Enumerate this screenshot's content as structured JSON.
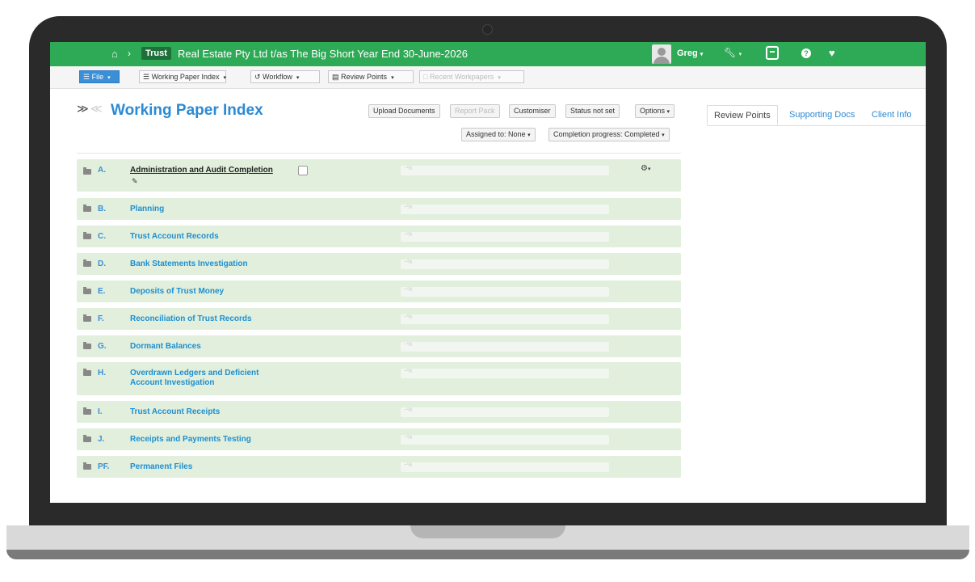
{
  "header": {
    "badge": "Trust",
    "title": "Real Estate Pty Ltd t/as The Big Short  Year End 30-June-2026",
    "user": "Greg",
    "colors": {
      "bar": "#2eaa56",
      "badge": "#1f6f3a"
    }
  },
  "toolbar": {
    "file": "File",
    "working_paper_index": "Working Paper Index",
    "workflow": "Workflow",
    "review_points": "Review Points",
    "recent_workpapers": "Recent Workpapers"
  },
  "main": {
    "title": "Working Paper Index",
    "buttons": {
      "upload": "Upload Documents",
      "report_pack": "Report Pack",
      "customiser": "Customiser",
      "status": "Status not set",
      "options": "Options",
      "assigned": "Assigned to: None",
      "completion": "Completion progress: Completed"
    },
    "rows": [
      {
        "code": "A.",
        "name": "Administration and Audit Completion",
        "bar": "~%"
      },
      {
        "code": "B.",
        "name": "Planning",
        "bar": "~%"
      },
      {
        "code": "C.",
        "name": "Trust Account Records",
        "bar": "~%"
      },
      {
        "code": "D.",
        "name": "Bank Statements Investigation",
        "bar": "~%"
      },
      {
        "code": "E.",
        "name": "Deposits of Trust Money",
        "bar": "~%"
      },
      {
        "code": "F.",
        "name": "Reconciliation of Trust Records",
        "bar": "~%"
      },
      {
        "code": "G.",
        "name": "Dormant Balances",
        "bar": "~%"
      },
      {
        "code": "H.",
        "name": "Overdrawn Ledgers and Deficient Account Investigation",
        "bar": "~%"
      },
      {
        "code": "I.",
        "name": "Trust Account Receipts",
        "bar": "~%"
      },
      {
        "code": "J.",
        "name": "Receipts and Payments Testing",
        "bar": "~%"
      },
      {
        "code": "PF.",
        "name": "Permanent Files",
        "bar": "~%"
      }
    ]
  },
  "tabs": {
    "review_points": "Review Points",
    "supporting_docs": "Supporting Docs",
    "client_info": "Client Info"
  }
}
